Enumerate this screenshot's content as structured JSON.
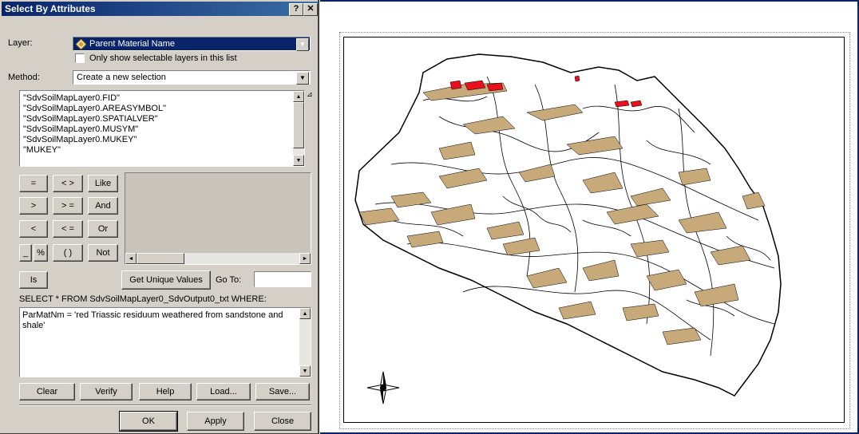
{
  "dialog": {
    "title": "Select By Attributes",
    "help_btn": "?",
    "close_btn": "✕",
    "layer_label": "Layer:",
    "layer_value": "Parent Material Name",
    "only_selectable_label": "Only show selectable layers in this list",
    "method_label": "Method:",
    "method_value": "Create a new selection",
    "fields": [
      "\"SdvSoilMapLayer0.FID\"",
      "\"SdvSoilMapLayer0.AREASYMBOL\"",
      "\"SdvSoilMapLayer0.SPATIALVER\"",
      "\"SdvSoilMapLayer0.MUSYM\"",
      "\"SdvSoilMapLayer0.MUKEY\"",
      "\"MUKEY\""
    ],
    "operators": {
      "eq": "=",
      "ne": "< >",
      "like": "Like",
      "gt": ">",
      "ge": "> =",
      "and": "And",
      "lt": "<",
      "le": "< =",
      "or": "Or",
      "underscore": "_",
      "percent": "%",
      "parens": "( )",
      "not": "Not",
      "is": "Is"
    },
    "get_unique_values": "Get Unique Values",
    "go_to_label": "Go To:",
    "sql_prefix": "SELECT * FROM SdvSoilMapLayer0_SdvOutput0_txt WHERE:",
    "expression": "ParMatNm = 'red Triassic residuum weathered from sandstone and shale'",
    "buttons": {
      "clear": "Clear",
      "verify": "Verify",
      "help": "Help",
      "load": "Load...",
      "save": "Save...",
      "ok": "OK",
      "apply": "Apply",
      "close": "Close"
    }
  },
  "map": {
    "polygon_fill": "#c8a97a",
    "selected_fill": "#e8101a",
    "north_arrow": "north-arrow-icon"
  },
  "colors": {
    "title_bar": "#0a246a",
    "dialog_face": "#d4d0c8"
  }
}
